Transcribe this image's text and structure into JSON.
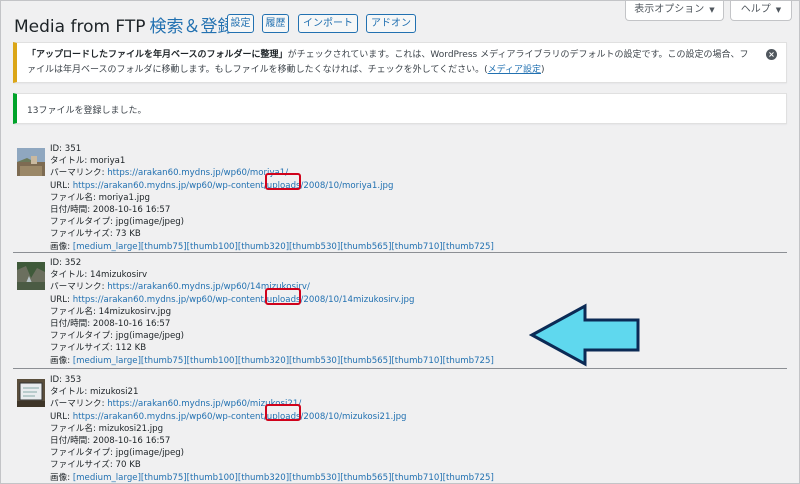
{
  "header": {
    "title": "Media from FTP",
    "subtitle": "検索＆登録",
    "buttons": [
      {
        "label": "設定"
      },
      {
        "label": "履歴"
      },
      {
        "label": "インポート"
      },
      {
        "label": "アドオン"
      }
    ],
    "screen_options_label": "表示オプション",
    "help_label": "ヘルプ"
  },
  "warning_notice": {
    "bold_text": "「アップロードしたファイルを年月ベースのフォルダーに整理」",
    "text": "がチェックされています。これは、WordPress メディアライブラリのデフォルトの設定です。この設定の場合、ファイルは年月ベースのフォルダに移動します。もしファイルを移動したくなければ、チェックを外してください。(",
    "link_label": "メディア設定",
    "end_text": ")"
  },
  "success_notice": {
    "text": "13ファイルを登録しました。"
  },
  "entries": [
    {
      "id": "ID: 351",
      "title_label": "タイトル: ",
      "title": "moriya1",
      "permalink_label": "パーマリンク: ",
      "permalink": "https://arakan60.mydns.jp/wp60/moriya1/",
      "url_label": "URL: ",
      "url_prefix": "https://arakan60.mydns.jp/wp60/wp-content/uploads",
      "url_date": "/2008/10/",
      "url_file": "moriya1.jpg",
      "filename": "ファイル名: moriya1.jpg",
      "datetime": "日付/時間: 2008-10-16 16:57",
      "filetype": "ファイルタイプ: jpg(image/jpeg)",
      "filesize": "ファイルサイズ: 73 KB",
      "images_label": "画像: ",
      "images": "[medium_large][thumb75][thumb100][thumb320][thumb530][thumb565][thumb710][thumb725]"
    },
    {
      "id": "ID: 352",
      "title_label": "タイトル: ",
      "title": "14mizukosirv",
      "permalink_label": "パーマリンク: ",
      "permalink": "https://arakan60.mydns.jp/wp60/14mizukosirv/",
      "url_label": "URL: ",
      "url_prefix": "https://arakan60.mydns.jp/wp60/wp-content/uploads",
      "url_date": "/2008/10/",
      "url_file": "14mizukosirv.jpg",
      "filename": "ファイル名: 14mizukosirv.jpg",
      "datetime": "日付/時間: 2008-10-16 16:57",
      "filetype": "ファイルタイプ: jpg(image/jpeg)",
      "filesize": "ファイルサイズ: 112 KB",
      "images_label": "画像: ",
      "images": "[medium_large][thumb75][thumb100][thumb320][thumb530][thumb565][thumb710][thumb725]"
    },
    {
      "id": "ID: 353",
      "title_label": "タイトル: ",
      "title": "mizukosi21",
      "permalink_label": "パーマリンク: ",
      "permalink": "https://arakan60.mydns.jp/wp60/mizukosi21/",
      "url_label": "URL: ",
      "url_prefix": "https://arakan60.mydns.jp/wp60/wp-content/uploads",
      "url_date": "/2008/10/",
      "url_file": "mizukosi21.jpg",
      "filename": "ファイル名: mizukosi21.jpg",
      "datetime": "日付/時間: 2008-10-16 16:57",
      "filetype": "ファイルタイプ: jpg(image/jpeg)",
      "filesize": "ファイルサイズ: 70 KB",
      "images_label": "画像: ",
      "images": "[medium_large][thumb75][thumb100][thumb320][thumb530][thumb565][thumb710][thumb725]"
    }
  ],
  "colors": {
    "link": "#2271b1",
    "warning_border": "#dba617",
    "success_border": "#00a32a",
    "highlight": "#d0021b",
    "arrow_fill": "#5fd8ee",
    "arrow_stroke": "#0b2a55"
  },
  "icons": {
    "dismiss": "close-circle-icon",
    "annotation": "left-arrow-icon"
  }
}
